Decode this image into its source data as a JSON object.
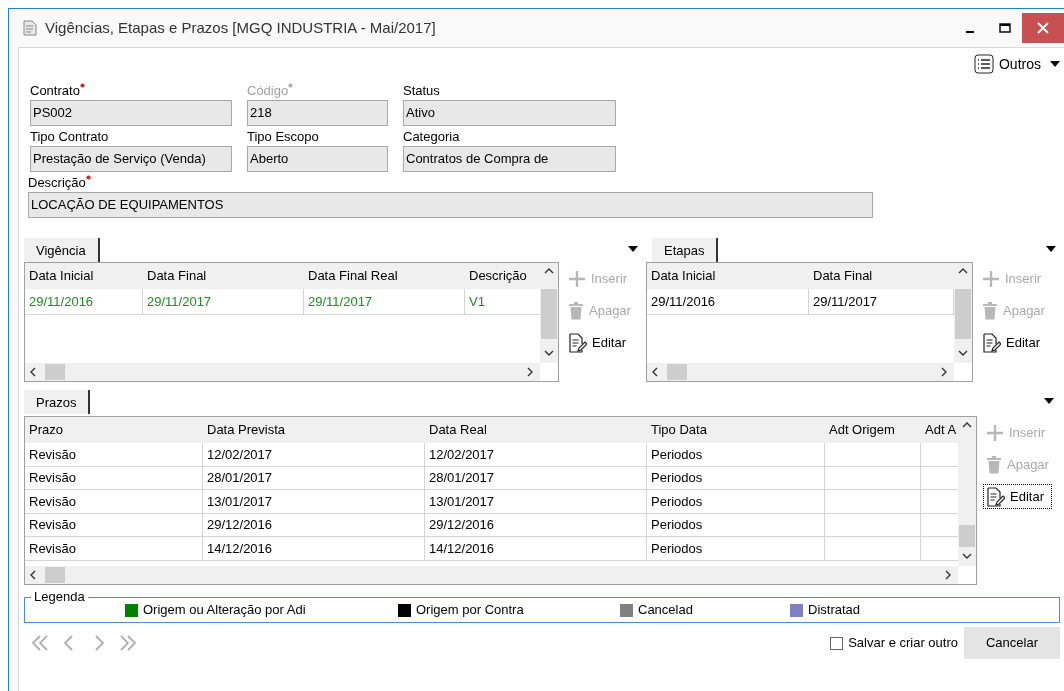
{
  "window": {
    "title": "Vigências, Etapas e Prazos [MGQ INDUSTRIA - Mai/2017]"
  },
  "toolbar": {
    "menu_label": "Outros"
  },
  "fields": [
    {
      "label": "Contrato",
      "value": "PS002",
      "required": true,
      "disabled": false
    },
    {
      "label": "Código",
      "value": "218",
      "required": true,
      "disabled": true
    },
    {
      "label": "Status",
      "value": "Ativo",
      "required": false,
      "disabled": false
    },
    {
      "label": "Tipo Contrato",
      "value": "Prestação de Serviço (Venda)",
      "required": false,
      "disabled": false
    },
    {
      "label": "Tipo Escopo",
      "value": "Aberto",
      "required": false,
      "disabled": false
    },
    {
      "label": "Categoria",
      "value": "Contratos de Compra de",
      "required": false,
      "disabled": false
    },
    {
      "label": "Descrição",
      "value": "LOCAÇÃO DE EQUIPAMENTOS",
      "required": true,
      "disabled": false
    }
  ],
  "vigencia": {
    "tab": "Vigência",
    "columns": [
      "Data Inicial",
      "Data Final",
      "Data Final Real",
      "Descrição"
    ],
    "rows": [
      {
        "cells": [
          "29/11/2016",
          "29/11/2017",
          "29/11/2017",
          "V1"
        ],
        "color": "#1e8c1e"
      }
    ],
    "actions": [
      {
        "kind": "add",
        "label": "Inserir",
        "disabled": true,
        "focused": false
      },
      {
        "kind": "delete",
        "label": "Apagar",
        "disabled": true,
        "focused": false
      },
      {
        "kind": "edit",
        "label": "Editar",
        "disabled": false,
        "focused": false
      }
    ]
  },
  "etapas": {
    "tab": "Etapas",
    "columns": [
      "Data Inicial",
      "Data Final"
    ],
    "rows": [
      {
        "cells": [
          "29/11/2016",
          "29/11/2017"
        ],
        "color": "#000000"
      }
    ],
    "actions": [
      {
        "kind": "add",
        "label": "Inserir",
        "disabled": true,
        "focused": false
      },
      {
        "kind": "delete",
        "label": "Apagar",
        "disabled": true,
        "focused": false
      },
      {
        "kind": "edit",
        "label": "Editar",
        "disabled": false,
        "focused": false
      }
    ]
  },
  "prazos": {
    "tab": "Prazos",
    "columns": [
      "Prazo",
      "Data Prevista",
      "Data Real",
      "Tipo Data",
      "Adt Origem",
      "Adt A"
    ],
    "rows": [
      {
        "cells": [
          "Revisão",
          "12/02/2017",
          "12/02/2017",
          "Periodos",
          "",
          ""
        ],
        "color": "#000000"
      },
      {
        "cells": [
          "Revisão",
          "28/01/2017",
          "28/01/2017",
          "Periodos",
          "",
          ""
        ],
        "color": "#000000"
      },
      {
        "cells": [
          "Revisão",
          "13/01/2017",
          "13/01/2017",
          "Periodos",
          "",
          ""
        ],
        "color": "#000000"
      },
      {
        "cells": [
          "Revisão",
          "29/12/2016",
          "29/12/2016",
          "Periodos",
          "",
          ""
        ],
        "color": "#000000"
      },
      {
        "cells": [
          "Revisão",
          "14/12/2016",
          "14/12/2016",
          "Periodos",
          "",
          ""
        ],
        "color": "#000000"
      }
    ],
    "actions": [
      {
        "kind": "add",
        "label": "Inserir",
        "disabled": true,
        "focused": false
      },
      {
        "kind": "delete",
        "label": "Apagar",
        "disabled": true,
        "focused": false
      },
      {
        "kind": "edit",
        "label": "Editar",
        "disabled": false,
        "focused": true
      }
    ]
  },
  "legend": {
    "title": "Legenda",
    "items": [
      {
        "label": "Origem ou Alteração por Adi",
        "color": "#008000"
      },
      {
        "label": "Origem por Contra",
        "color": "#000000"
      },
      {
        "label": "Cancelad",
        "color": "#808080"
      },
      {
        "label": "Distratad",
        "color": "#8080c0"
      }
    ]
  },
  "footer": {
    "save_and_new": {
      "label": "Salvar e criar outro",
      "checked": false
    },
    "cancel": "Cancelar"
  }
}
